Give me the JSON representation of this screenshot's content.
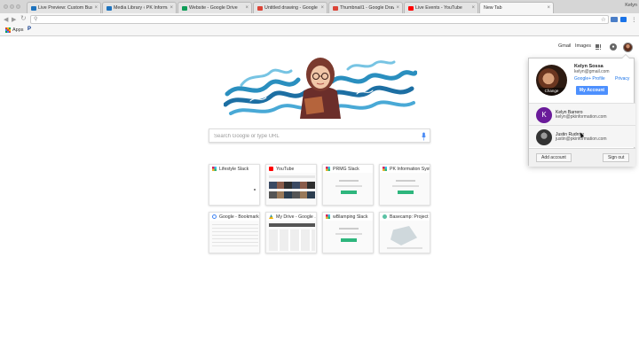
{
  "browser": {
    "profile_name": "Kelyn",
    "tabs": [
      {
        "title": "Live Preview: Custom Business...",
        "favicon_color": "#1e73be",
        "active": false
      },
      {
        "title": "Media Library ‹ PK Information...",
        "favicon_color": "#1e73be",
        "active": false
      },
      {
        "title": "Website - Google Drive",
        "favicon_color": "#0f9d58",
        "active": false
      },
      {
        "title": "Untitled drawing - Google Dra...",
        "favicon_color": "#db4437",
        "active": false
      },
      {
        "title": "Thumbnail1 - Google Drawings",
        "favicon_color": "#db4437",
        "active": false
      },
      {
        "title": "Live Events - YouTube",
        "favicon_color": "#ff0000",
        "active": false
      },
      {
        "title": "New Tab",
        "favicon_color": "#cccccc",
        "active": true
      }
    ],
    "close_glyph": "×",
    "omnibox": {
      "value": "",
      "search_icon": "search-icon"
    },
    "bookmarks": [
      {
        "label": "Apps",
        "icon": "apps-grid-icon"
      },
      {
        "label": "",
        "icon": "paypal-icon"
      }
    ]
  },
  "google_header": {
    "gmail": "Gmail",
    "images": "Images",
    "apps_icon": "apps-grid-icon",
    "notifications_icon": "bell-icon"
  },
  "search": {
    "placeholder": "Search Google or type URL",
    "mic_icon": "mic-icon"
  },
  "tiles": [
    {
      "title": "Lifestyle Slack",
      "icon": "slack-icon"
    },
    {
      "title": "YouTube",
      "icon": "youtube-icon"
    },
    {
      "title": "PRMG Slack",
      "icon": "slack-icon"
    },
    {
      "title": "PK Information Syst...",
      "icon": "slack-icon"
    },
    {
      "title": "Google - Bookmarks",
      "icon": "google-icon"
    },
    {
      "title": "My Drive - Google ...",
      "icon": "drive-icon"
    },
    {
      "title": "wBlamping Slack",
      "icon": "slack-icon"
    },
    {
      "title": "Basecamp: Project ...",
      "icon": "basecamp-icon"
    }
  ],
  "account_popup": {
    "name": "Kelyn Sossa",
    "email": "kelyn@gmail.com",
    "change_label": "Change",
    "google_profile": "Google+ Profile",
    "privacy": "Privacy",
    "my_account": "My Account",
    "other_accounts": [
      {
        "initial": "K",
        "name": "Kelyn Barrero",
        "email": "kelyn@pkinformation.com",
        "color": "#6a1b9a"
      },
      {
        "initial": "",
        "name": "Justin Rudrow",
        "email": "justin@pkinformation.com",
        "color": "#333333"
      }
    ],
    "add_account": "Add account",
    "sign_out": "Sign out"
  },
  "colors": {
    "accent_blue": "#4d90fe",
    "link_blue": "#1a73e8",
    "wave_blue": "#2a8fbf"
  }
}
